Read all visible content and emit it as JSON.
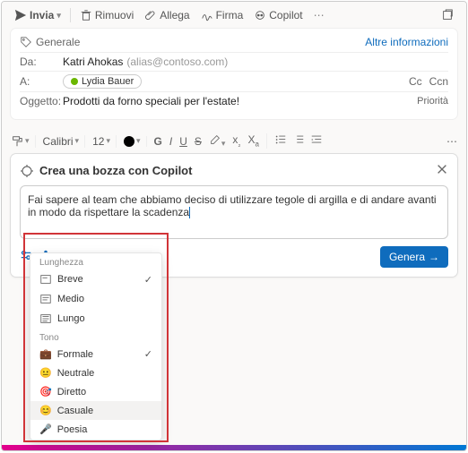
{
  "toolbar": {
    "send": "Invia",
    "remove": "Rimuovi",
    "attach": "Allega",
    "sign": "Firma",
    "copilot": "Copilot"
  },
  "tag": {
    "general": "Generale",
    "more_info": "Altre informazioni"
  },
  "from": {
    "label": "Da:",
    "name": "Katri Ahokas",
    "alias": "(alias@contoso.com)"
  },
  "to": {
    "label": "A:",
    "recipient": "Lydia Bauer",
    "cc": "Cc",
    "bcc": "Ccn"
  },
  "subject": {
    "label": "Oggetto:",
    "value": "Prodotti da forno speciali per l'estate!",
    "priority": "Priorità"
  },
  "format": {
    "font": "Calibri",
    "size": "12"
  },
  "copilot": {
    "title": "Crea una bozza con Copilot",
    "prompt": "Fai sapere al team che abbiamo deciso di utilizzare tegole di argilla e di andare avanti in modo da rispettare la scadenza",
    "generate": "Genera"
  },
  "options": {
    "length_header": "Lunghezza",
    "length": [
      {
        "label": "Breve",
        "checked": true
      },
      {
        "label": "Medio",
        "checked": false
      },
      {
        "label": "Lungo",
        "checked": false
      }
    ],
    "tone_header": "Tono",
    "tone": [
      {
        "label": "Formale",
        "checked": true,
        "emoji": "💼"
      },
      {
        "label": "Neutrale",
        "checked": false,
        "emoji": "😐"
      },
      {
        "label": "Diretto",
        "checked": false,
        "emoji": "🎯"
      },
      {
        "label": "Casuale",
        "checked": false,
        "emoji": "😊",
        "highlight": true
      },
      {
        "label": "Poesia",
        "checked": false,
        "emoji": "🎤"
      }
    ]
  }
}
